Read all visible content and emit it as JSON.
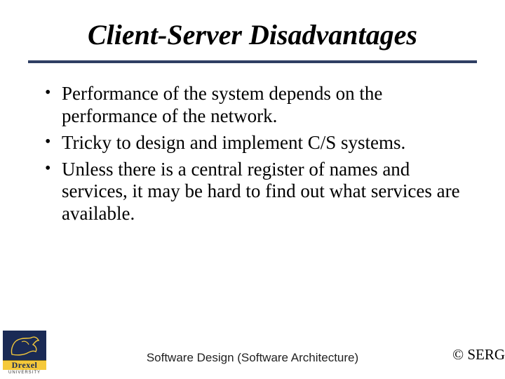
{
  "title": "Client-Server Disadvantages",
  "bullets": [
    "Performance of the system depends on the performance of the network.",
    "Tricky to design and implement C/S systems.",
    "Unless there is a central register of names and services, it may be hard to find out what services are available."
  ],
  "footer": {
    "center": "Software Design (Software Architecture)",
    "right": "© SERG"
  },
  "logo": {
    "name": "Drexel",
    "sub": "UNIVERSITY",
    "svg_stroke": "#f5c93a"
  }
}
